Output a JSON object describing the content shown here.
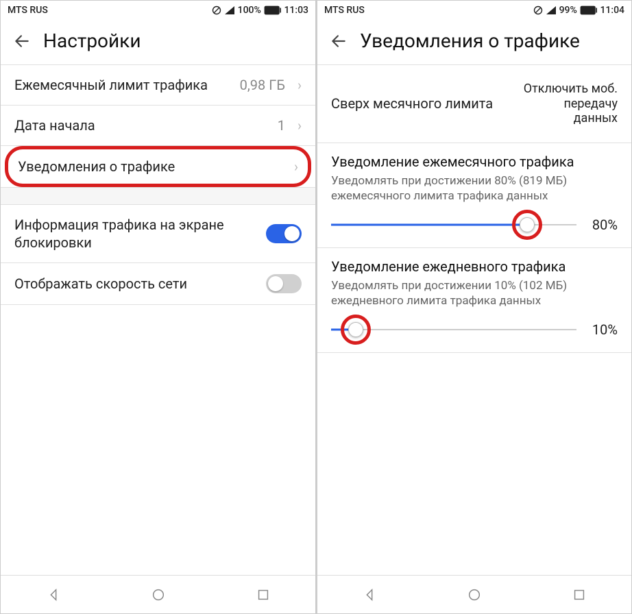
{
  "left": {
    "status": {
      "carrier": "MTS RUS",
      "battery_pct": "100%",
      "time": "11:03"
    },
    "header": {
      "title": "Настройки"
    },
    "rows": {
      "monthly_limit": {
        "label": "Ежемесячный лимит трафика",
        "value": "0,98 ГБ"
      },
      "start_date": {
        "label": "Дата начала",
        "value": "1"
      },
      "traffic_notif": {
        "label": "Уведомления о трафике"
      },
      "lockscreen_info": {
        "label": "Информация трафика на экране блокировки",
        "toggle": "on"
      },
      "show_speed": {
        "label": "Отображать скорость сети",
        "toggle": "off"
      }
    }
  },
  "right": {
    "status": {
      "carrier": "MTS RUS",
      "battery_pct": "99%",
      "time": "11:04"
    },
    "header": {
      "title": "Уведомления о трафике"
    },
    "over_limit": {
      "label": "Сверх месячного лимита",
      "value": "Отключить моб. передачу данных"
    },
    "monthly": {
      "title": "Уведомление ежемесячного трафика",
      "desc": "Уведомлять при достижении 80% (819 МБ) ежемесячного лимита трафика данных",
      "pct_label": "80%",
      "pct_value": 80
    },
    "daily": {
      "title": "Уведомление ежедневного трафика",
      "desc": "Уведомлять при достижении 10% (102 МБ) ежедневного лимита трафика данных",
      "pct_label": "10%",
      "pct_value": 10
    }
  }
}
